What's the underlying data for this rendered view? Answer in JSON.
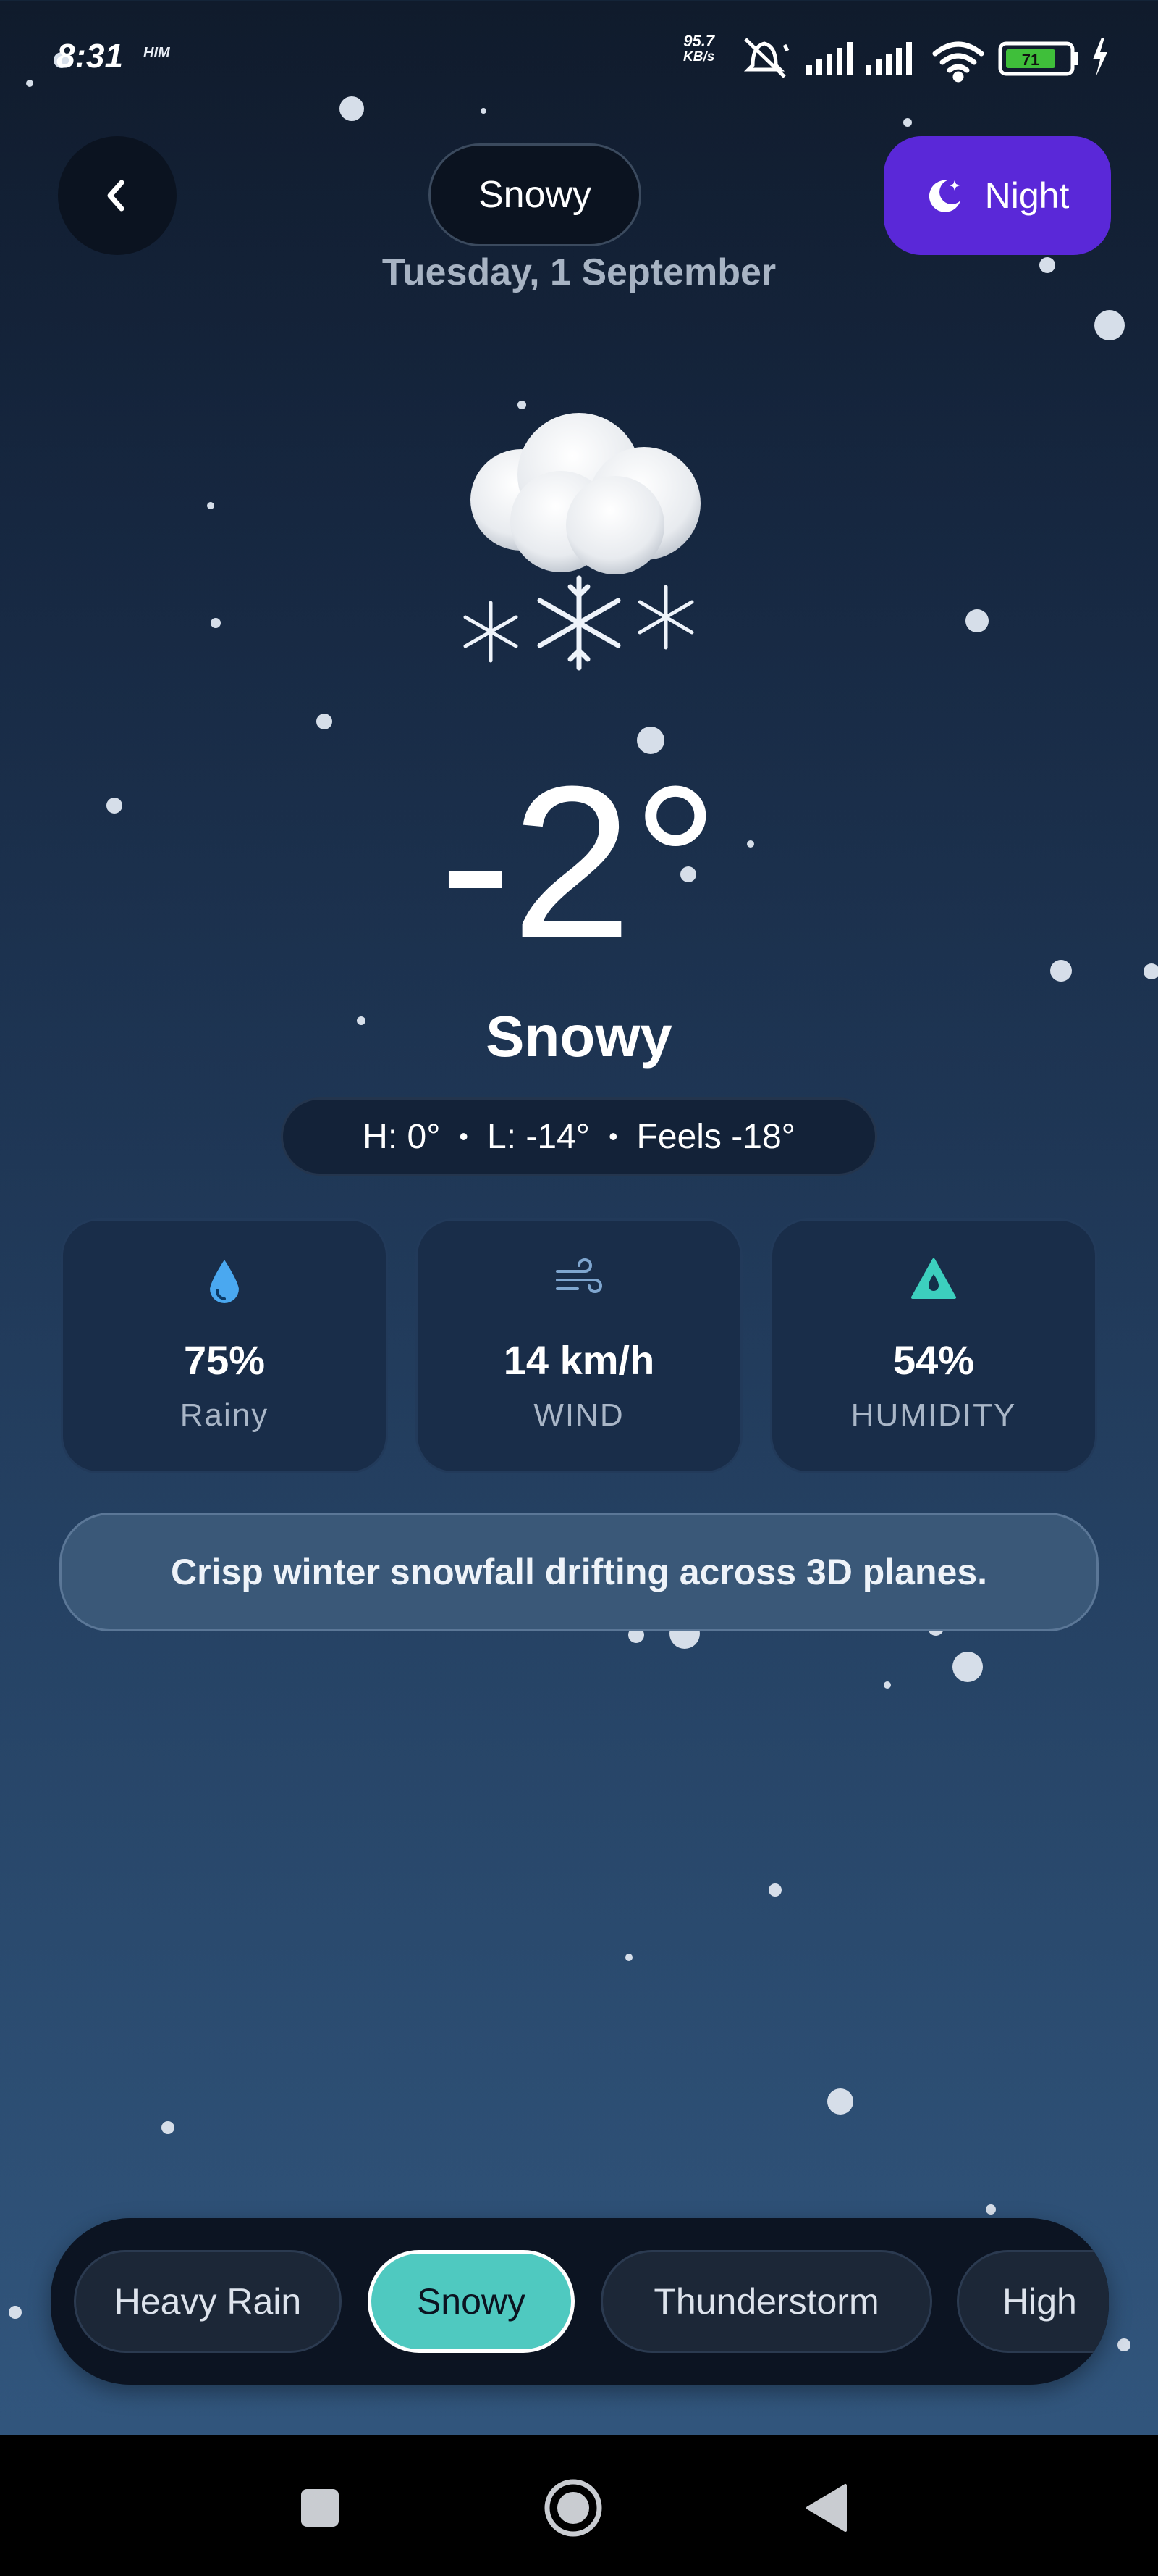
{
  "status_bar": {
    "time": "8:31",
    "carrier": "HIM",
    "net_speed_value": "95.7",
    "net_speed_unit": "KB/s",
    "battery": "71",
    "icons": [
      "mute-icon",
      "signal-icon",
      "signal-icon",
      "wifi-icon",
      "battery-icon",
      "charging-icon"
    ]
  },
  "header": {
    "back_icon": "chevron-left-icon",
    "title": "Snowy",
    "date": "Tuesday, 1 September",
    "mode_label": "Night",
    "mode_icon": "moon-icon"
  },
  "current": {
    "icon": "cloud-snow-icon",
    "temperature": "-2°",
    "condition": "Snowy",
    "high": "H: 0°",
    "low": "L: -14°",
    "feels": "Feels -18°",
    "separator": "•"
  },
  "stats": [
    {
      "icon": "droplet-icon",
      "value": "75%",
      "label": "Rainy",
      "color": "#4aa8f0"
    },
    {
      "icon": "wind-icon",
      "value": "14 km/h",
      "label": "WIND",
      "color": "#7fa6cf"
    },
    {
      "icon": "humidity-icon",
      "value": "54%",
      "label": "HUMIDITY",
      "color": "#3ccfbe"
    }
  ],
  "description": "Crisp winter snowfall drifting across 3D planes.",
  "weather_chips": [
    {
      "label": "Heavy Rain",
      "active": false
    },
    {
      "label": "Snowy",
      "active": true
    },
    {
      "label": "Thunderstorm",
      "active": false
    },
    {
      "label": "High",
      "active": false
    }
  ],
  "nav": {
    "icons": [
      "square-icon",
      "circle-icon",
      "triangle-back-icon"
    ]
  },
  "colors": {
    "accent_night": "#5a28d8",
    "chip_active": "#4fc9c0",
    "background_top": "#101b2c",
    "background_bottom": "#31557c"
  }
}
